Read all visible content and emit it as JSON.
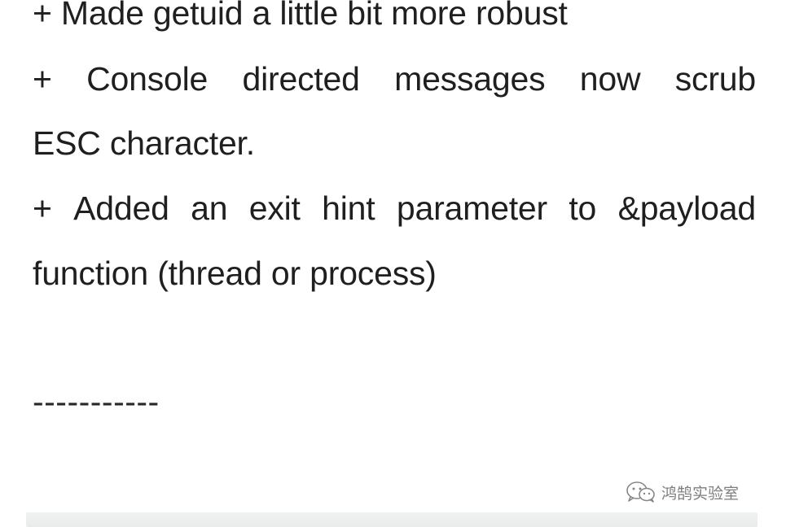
{
  "changelog": {
    "line1": "+ Made getuid a little bit more robust",
    "line2_words": [
      "+",
      "Console",
      "directed",
      "messages",
      "now",
      "scrub"
    ],
    "line3": "ESC character.",
    "line4_words": [
      "+",
      "Added",
      "an",
      "exit",
      "hint",
      "parameter",
      "to",
      "&payload"
    ],
    "line5": "function (thread or process)",
    "divider": "-----------"
  },
  "watermark": {
    "text": "鸿鹄实验室",
    "icon": "wechat-icon"
  },
  "colors": {
    "text": "#1f1f1f",
    "watermark": "#6f6f6f",
    "background": "#ffffff"
  }
}
